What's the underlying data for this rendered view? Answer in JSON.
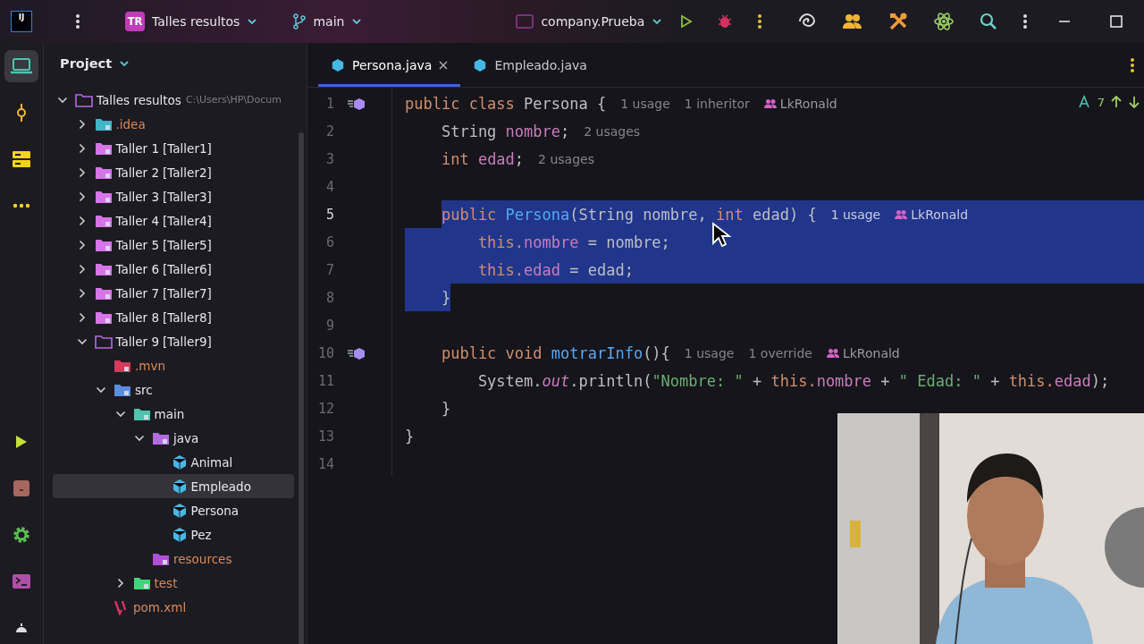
{
  "title_bar": {
    "logo_text": "IJ",
    "project_badge": "TR",
    "project": "Talles resultos",
    "branch": "main",
    "run_config": "company.Prueba"
  },
  "tool_strip": {
    "top": [
      {
        "kind": "project",
        "selected": true
      },
      {
        "kind": "commit",
        "selected": false
      },
      {
        "kind": "structure",
        "selected": false
      },
      {
        "kind": "more",
        "selected": false
      }
    ],
    "bottom": [
      {
        "kind": "run",
        "selected": false
      },
      {
        "kind": "services",
        "selected": false
      },
      {
        "kind": "settings",
        "selected": false
      },
      {
        "kind": "terminal",
        "selected": false
      },
      {
        "kind": "problems",
        "selected": false
      }
    ]
  },
  "project_panel": {
    "title": "Project",
    "tree": [
      {
        "name": "Talles resultos",
        "path": "C:\\Users\\HP\\Docum",
        "kind": "project",
        "expanded": true,
        "selected": false,
        "ignored": false,
        "children": [
          {
            "name": ".idea",
            "kind": "idea",
            "expanded": false,
            "selected": false,
            "ignored": true
          },
          {
            "name": "Taller 1",
            "suffix": "[Taller1]",
            "kind": "module",
            "expanded": false,
            "selected": false,
            "ignored": false
          },
          {
            "name": "Taller 2",
            "suffix": "[Taller2]",
            "kind": "module",
            "expanded": false,
            "selected": false,
            "ignored": false
          },
          {
            "name": "Taller 3",
            "suffix": "[Taller3]",
            "kind": "module",
            "expanded": false,
            "selected": false,
            "ignored": false
          },
          {
            "name": "Taller 4",
            "suffix": "[Taller4]",
            "kind": "module",
            "expanded": false,
            "selected": false,
            "ignored": false
          },
          {
            "name": "Taller 5",
            "suffix": "[Taller5]",
            "kind": "module",
            "expanded": false,
            "selected": false,
            "ignored": false
          },
          {
            "name": "Taller 6",
            "suffix": "[Taller6]",
            "kind": "module",
            "expanded": false,
            "selected": false,
            "ignored": false
          },
          {
            "name": "Taller 7",
            "suffix": "[Taller7]",
            "kind": "module",
            "expanded": false,
            "selected": false,
            "ignored": false
          },
          {
            "name": "Taller 8",
            "suffix": "[Taller8]",
            "kind": "module",
            "expanded": false,
            "selected": false,
            "ignored": false
          },
          {
            "name": "Taller 9",
            "suffix": "[Taller9]",
            "kind": "project",
            "expanded": true,
            "selected": false,
            "ignored": false,
            "children": [
              {
                "name": ".mvn",
                "kind": "mvn",
                "selected": false,
                "ignored": true
              },
              {
                "name": "src",
                "kind": "src",
                "expanded": true,
                "selected": false,
                "ignored": false,
                "children": [
                  {
                    "name": "main",
                    "kind": "main",
                    "expanded": true,
                    "selected": false,
                    "ignored": false,
                    "children": [
                      {
                        "name": "java",
                        "kind": "java",
                        "expanded": true,
                        "selected": false,
                        "ignored": false,
                        "children": [
                          {
                            "name": "Animal",
                            "kind": "class",
                            "selected": false,
                            "ignored": false
                          },
                          {
                            "name": "Empleado",
                            "kind": "class",
                            "selected": true,
                            "ignored": false
                          },
                          {
                            "name": "Persona",
                            "kind": "class",
                            "selected": false,
                            "ignored": false
                          },
                          {
                            "name": "Pez",
                            "kind": "class",
                            "selected": false,
                            "ignored": false
                          }
                        ]
                      },
                      {
                        "name": "resources",
                        "kind": "resources",
                        "selected": false,
                        "ignored": true
                      }
                    ]
                  },
                  {
                    "name": "test",
                    "kind": "test",
                    "expanded": false,
                    "selected": false,
                    "ignored": true
                  }
                ]
              },
              {
                "name": "pom.xml",
                "kind": "maven",
                "selected": false,
                "ignored": true
              }
            ]
          }
        ]
      }
    ]
  },
  "tabs": [
    {
      "label": "Persona.java",
      "selected": true
    },
    {
      "label": "Empleado.java",
      "selected": false
    }
  ],
  "editor": {
    "inspection_count": "7",
    "lines": [
      {
        "number": "1",
        "gutter_icon": true,
        "caret": false,
        "selected": false,
        "tokens": [
          {
            "text": "public class ",
            "kind": "kw"
          },
          {
            "text": "Persona {",
            "kind": "plain"
          }
        ],
        "hints": [
          {
            "text": "1 usage",
            "kind": "hint"
          },
          {
            "text": "1 inheritor",
            "kind": "hint"
          },
          {
            "text": "LkRonald",
            "kind": "author"
          }
        ]
      },
      {
        "number": "2",
        "gutter_icon": false,
        "caret": false,
        "selected": false,
        "tokens": [
          {
            "text": "String ",
            "kind": "plain"
          },
          {
            "text": "nombre",
            "kind": "field"
          },
          {
            "text": ";",
            "kind": "plain"
          }
        ],
        "hints": [
          {
            "text": "2 usages",
            "kind": "hint"
          }
        ]
      },
      {
        "number": "3",
        "gutter_icon": false,
        "caret": false,
        "selected": false,
        "tokens": [
          {
            "text": "int ",
            "kind": "kw"
          },
          {
            "text": "edad",
            "kind": "field"
          },
          {
            "text": ";",
            "kind": "plain"
          }
        ],
        "hints": [
          {
            "text": "2 usages",
            "kind": "hint"
          }
        ]
      },
      {
        "number": "4",
        "gutter_icon": false,
        "caret": false,
        "selected": false
      },
      {
        "number": "5",
        "gutter_icon": false,
        "caret": true,
        "selected": true,
        "tokens": [
          {
            "text": "public ",
            "kind": "kw"
          },
          {
            "text": "Persona",
            "kind": "method"
          },
          {
            "text": "(String nombre, ",
            "kind": "plain"
          },
          {
            "text": "int ",
            "kind": "kw"
          },
          {
            "text": "edad) {",
            "kind": "plain"
          }
        ],
        "hints": [
          {
            "text": "1 usage",
            "kind": "hint"
          },
          {
            "text": "LkRonald",
            "kind": "author"
          }
        ]
      },
      {
        "number": "6",
        "gutter_icon": false,
        "caret": false,
        "selected": true,
        "tokens": [
          {
            "text": "this.",
            "kind": "kw"
          },
          {
            "text": "nombre",
            "kind": "field"
          },
          {
            "text": " = nombre;",
            "kind": "plain"
          }
        ]
      },
      {
        "number": "7",
        "gutter_icon": false,
        "caret": false,
        "selected": true,
        "tokens": [
          {
            "text": "this.",
            "kind": "kw"
          },
          {
            "text": "edad",
            "kind": "field"
          },
          {
            "text": " = edad;",
            "kind": "plain"
          }
        ]
      },
      {
        "number": "8",
        "gutter_icon": false,
        "caret": false,
        "selected": true,
        "tokens": [
          {
            "text": "}",
            "kind": "plain"
          }
        ]
      },
      {
        "number": "9",
        "gutter_icon": false,
        "caret": false,
        "selected": false
      },
      {
        "number": "10",
        "gutter_icon": true,
        "caret": false,
        "selected": false,
        "tokens": [
          {
            "text": "public void ",
            "kind": "kw"
          },
          {
            "text": "motrarInfo",
            "kind": "method"
          },
          {
            "text": "(){",
            "kind": "plain"
          }
        ],
        "hints": [
          {
            "text": "1 usage",
            "kind": "hint"
          },
          {
            "text": "1 override",
            "kind": "hint"
          },
          {
            "text": "LkRonald",
            "kind": "author"
          }
        ]
      },
      {
        "number": "11",
        "gutter_icon": false,
        "caret": false,
        "selected": false,
        "tokens": [
          {
            "text": "System.",
            "kind": "plain"
          },
          {
            "text": "out",
            "kind": "static"
          },
          {
            "text": ".println(",
            "kind": "plain"
          },
          {
            "text": "\"Nombre: \"",
            "kind": "str"
          },
          {
            "text": " + ",
            "kind": "plain"
          },
          {
            "text": "this.",
            "kind": "kw"
          },
          {
            "text": "nombre",
            "kind": "field"
          },
          {
            "text": " + ",
            "kind": "plain"
          },
          {
            "text": "\" Edad: \"",
            "kind": "str"
          },
          {
            "text": " + ",
            "kind": "plain"
          },
          {
            "text": "this.",
            "kind": "kw"
          },
          {
            "text": "edad",
            "kind": "field"
          },
          {
            "text": ");",
            "kind": "plain"
          }
        ]
      },
      {
        "number": "12",
        "gutter_icon": false,
        "caret": false,
        "selected": false,
        "tokens": [
          {
            "text": "}",
            "kind": "plain"
          }
        ]
      },
      {
        "number": "13",
        "gutter_icon": false,
        "caret": false,
        "selected": false,
        "tokens": [
          {
            "text": "}",
            "kind": "plain"
          }
        ]
      },
      {
        "number": "14",
        "gutter_icon": false,
        "caret": false,
        "selected": false
      }
    ]
  }
}
